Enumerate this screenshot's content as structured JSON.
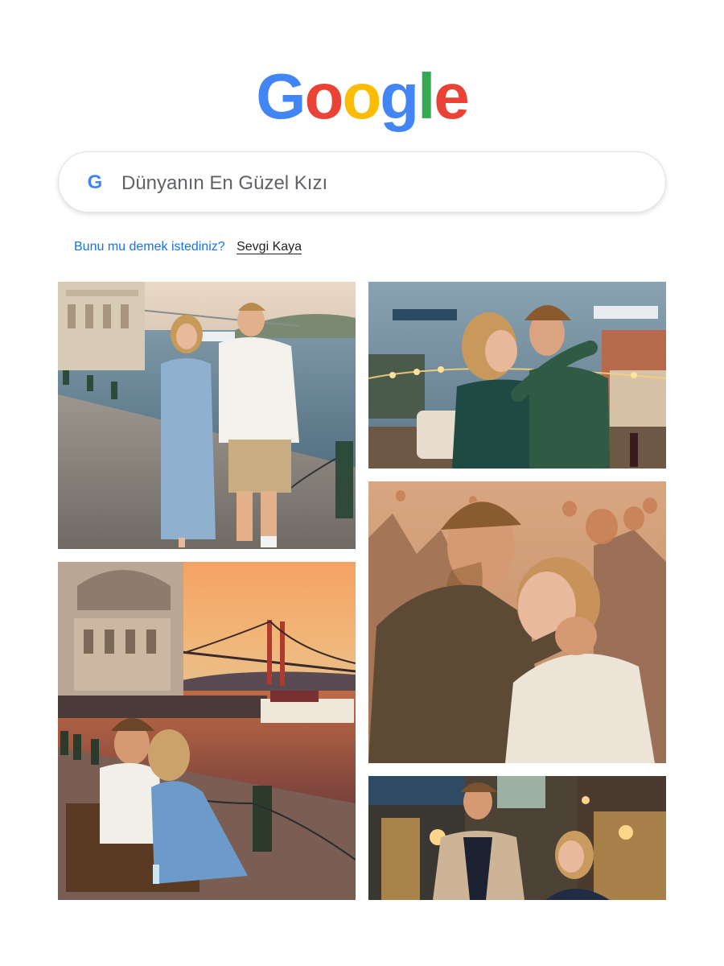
{
  "logo": {
    "letters": [
      "G",
      "o",
      "o",
      "g",
      "l",
      "e"
    ],
    "colors": [
      "#4285F4",
      "#EA4335",
      "#FBBC05",
      "#4285F4",
      "#34A853",
      "#EA4335"
    ]
  },
  "search": {
    "icon": "google-g-icon",
    "icon_letter": "G",
    "query": "Dünyanın En Güzel Kızı"
  },
  "did_you_mean": {
    "prompt": "Bunu mu demek istediniz?",
    "suggestion": "Sevgi Kaya"
  },
  "results": [
    {
      "name": "couple-walking-bosphorus-waterfront"
    },
    {
      "name": "couple-embracing-rooftop-bosphorus"
    },
    {
      "name": "couple-embracing-cappadocia-balloons"
    },
    {
      "name": "couple-bench-sunset-bosphorus-bridge"
    },
    {
      "name": "couple-evening-old-street"
    }
  ],
  "colors": {
    "suggestion_blue": "#1a73e8",
    "text_gray": "#5f6368"
  }
}
